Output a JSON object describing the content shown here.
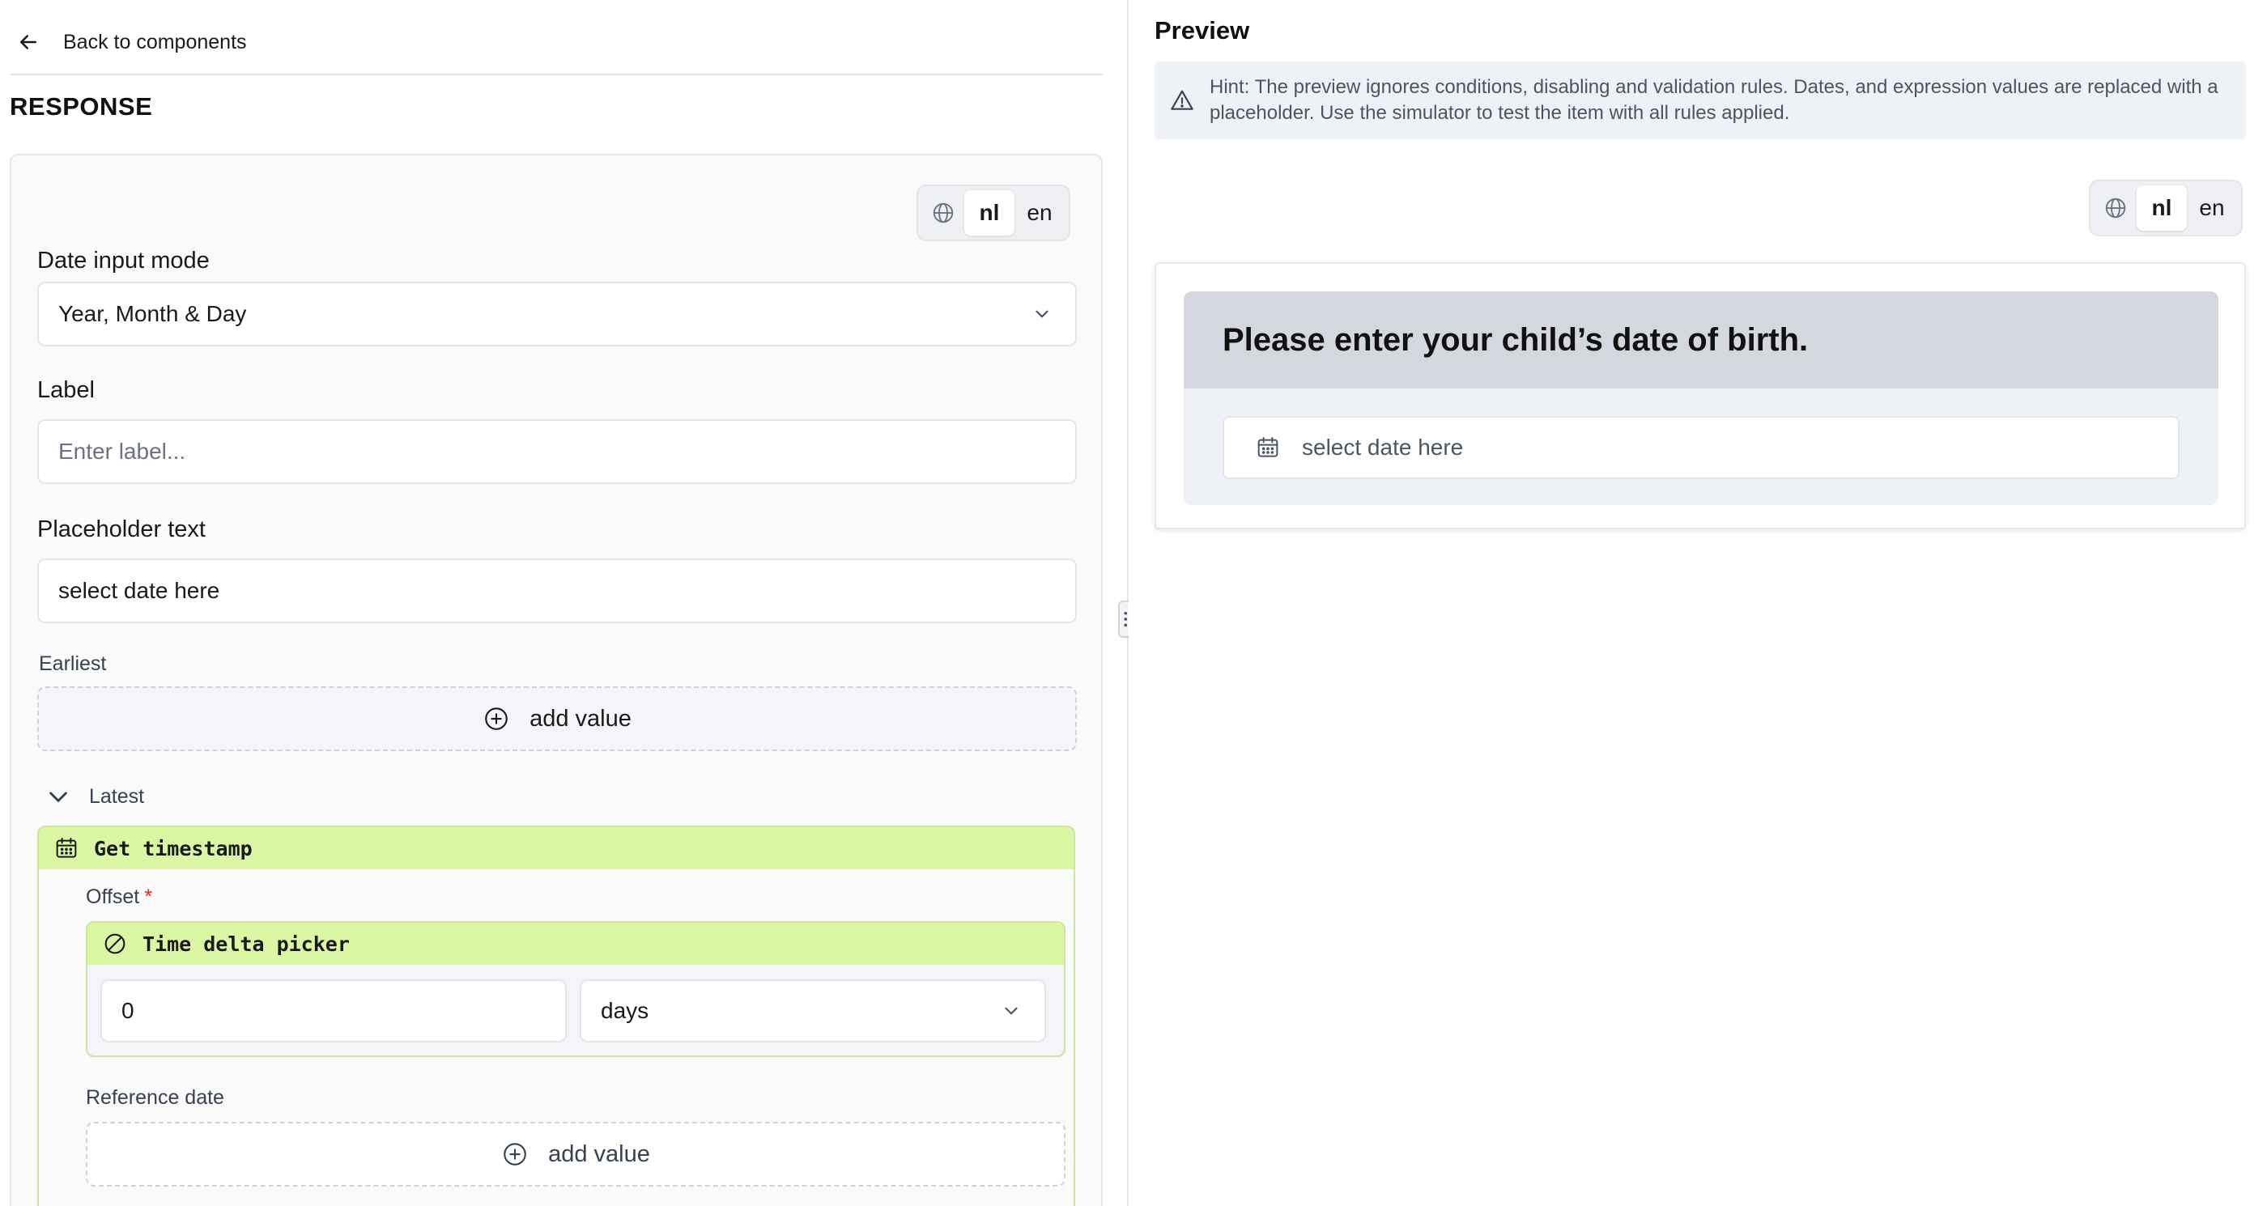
{
  "editor": {
    "back_label": "Back to components",
    "section_title": "RESPONSE",
    "languages": [
      "nl",
      "en"
    ],
    "active_language": "nl",
    "date_input_mode": {
      "label": "Date input mode",
      "value": "Year, Month & Day"
    },
    "label_field": {
      "label": "Label",
      "placeholder": "Enter label..."
    },
    "placeholder_field": {
      "label": "Placeholder text",
      "value": "select date here"
    },
    "earliest": {
      "label": "Earliest",
      "add_label": "add value"
    },
    "latest": {
      "label": "Latest",
      "expression": {
        "name": "Get timestamp",
        "icon": "calendar-icon",
        "offset": {
          "label": "Offset",
          "required_mark": "*",
          "picker": {
            "name": "Time delta picker",
            "icon": "no-circle-icon",
            "amount": "0",
            "unit": "days"
          }
        },
        "reference_date": {
          "label": "Reference date",
          "add_label": "add value"
        }
      }
    }
  },
  "preview": {
    "title": "Preview",
    "hint": "Hint: The preview ignores conditions, disabling and validation rules. Dates, and expression values are replaced with a placeholder. Use the simulator to test the item with all rules applied.",
    "languages": [
      "nl",
      "en"
    ],
    "active_language": "nl",
    "question": "Please enter your child’s date of birth.",
    "date_placeholder": "select date here"
  },
  "colors": {
    "expression_header": "#dcf7a4",
    "required": "#dc2626",
    "survey_header": "#d4d8de"
  }
}
